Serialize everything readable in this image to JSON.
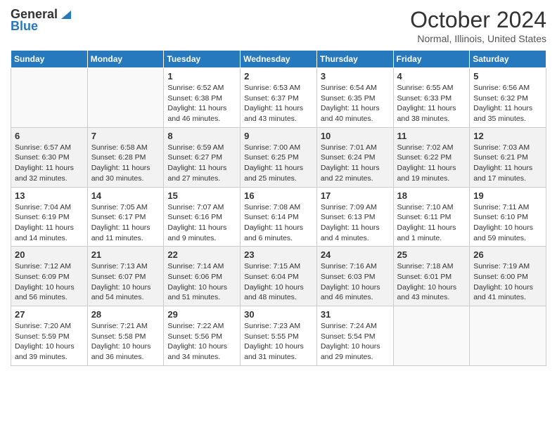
{
  "logo": {
    "general": "General",
    "blue": "Blue"
  },
  "title": "October 2024",
  "location": "Normal, Illinois, United States",
  "days_of_week": [
    "Sunday",
    "Monday",
    "Tuesday",
    "Wednesday",
    "Thursday",
    "Friday",
    "Saturday"
  ],
  "weeks": [
    [
      {
        "day": "",
        "detail": ""
      },
      {
        "day": "",
        "detail": ""
      },
      {
        "day": "1",
        "detail": "Sunrise: 6:52 AM\nSunset: 6:38 PM\nDaylight: 11 hours and 46 minutes."
      },
      {
        "day": "2",
        "detail": "Sunrise: 6:53 AM\nSunset: 6:37 PM\nDaylight: 11 hours and 43 minutes."
      },
      {
        "day": "3",
        "detail": "Sunrise: 6:54 AM\nSunset: 6:35 PM\nDaylight: 11 hours and 40 minutes."
      },
      {
        "day": "4",
        "detail": "Sunrise: 6:55 AM\nSunset: 6:33 PM\nDaylight: 11 hours and 38 minutes."
      },
      {
        "day": "5",
        "detail": "Sunrise: 6:56 AM\nSunset: 6:32 PM\nDaylight: 11 hours and 35 minutes."
      }
    ],
    [
      {
        "day": "6",
        "detail": "Sunrise: 6:57 AM\nSunset: 6:30 PM\nDaylight: 11 hours and 32 minutes."
      },
      {
        "day": "7",
        "detail": "Sunrise: 6:58 AM\nSunset: 6:28 PM\nDaylight: 11 hours and 30 minutes."
      },
      {
        "day": "8",
        "detail": "Sunrise: 6:59 AM\nSunset: 6:27 PM\nDaylight: 11 hours and 27 minutes."
      },
      {
        "day": "9",
        "detail": "Sunrise: 7:00 AM\nSunset: 6:25 PM\nDaylight: 11 hours and 25 minutes."
      },
      {
        "day": "10",
        "detail": "Sunrise: 7:01 AM\nSunset: 6:24 PM\nDaylight: 11 hours and 22 minutes."
      },
      {
        "day": "11",
        "detail": "Sunrise: 7:02 AM\nSunset: 6:22 PM\nDaylight: 11 hours and 19 minutes."
      },
      {
        "day": "12",
        "detail": "Sunrise: 7:03 AM\nSunset: 6:21 PM\nDaylight: 11 hours and 17 minutes."
      }
    ],
    [
      {
        "day": "13",
        "detail": "Sunrise: 7:04 AM\nSunset: 6:19 PM\nDaylight: 11 hours and 14 minutes."
      },
      {
        "day": "14",
        "detail": "Sunrise: 7:05 AM\nSunset: 6:17 PM\nDaylight: 11 hours and 11 minutes."
      },
      {
        "day": "15",
        "detail": "Sunrise: 7:07 AM\nSunset: 6:16 PM\nDaylight: 11 hours and 9 minutes."
      },
      {
        "day": "16",
        "detail": "Sunrise: 7:08 AM\nSunset: 6:14 PM\nDaylight: 11 hours and 6 minutes."
      },
      {
        "day": "17",
        "detail": "Sunrise: 7:09 AM\nSunset: 6:13 PM\nDaylight: 11 hours and 4 minutes."
      },
      {
        "day": "18",
        "detail": "Sunrise: 7:10 AM\nSunset: 6:11 PM\nDaylight: 11 hours and 1 minute."
      },
      {
        "day": "19",
        "detail": "Sunrise: 7:11 AM\nSunset: 6:10 PM\nDaylight: 10 hours and 59 minutes."
      }
    ],
    [
      {
        "day": "20",
        "detail": "Sunrise: 7:12 AM\nSunset: 6:09 PM\nDaylight: 10 hours and 56 minutes."
      },
      {
        "day": "21",
        "detail": "Sunrise: 7:13 AM\nSunset: 6:07 PM\nDaylight: 10 hours and 54 minutes."
      },
      {
        "day": "22",
        "detail": "Sunrise: 7:14 AM\nSunset: 6:06 PM\nDaylight: 10 hours and 51 minutes."
      },
      {
        "day": "23",
        "detail": "Sunrise: 7:15 AM\nSunset: 6:04 PM\nDaylight: 10 hours and 48 minutes."
      },
      {
        "day": "24",
        "detail": "Sunrise: 7:16 AM\nSunset: 6:03 PM\nDaylight: 10 hours and 46 minutes."
      },
      {
        "day": "25",
        "detail": "Sunrise: 7:18 AM\nSunset: 6:01 PM\nDaylight: 10 hours and 43 minutes."
      },
      {
        "day": "26",
        "detail": "Sunrise: 7:19 AM\nSunset: 6:00 PM\nDaylight: 10 hours and 41 minutes."
      }
    ],
    [
      {
        "day": "27",
        "detail": "Sunrise: 7:20 AM\nSunset: 5:59 PM\nDaylight: 10 hours and 39 minutes."
      },
      {
        "day": "28",
        "detail": "Sunrise: 7:21 AM\nSunset: 5:58 PM\nDaylight: 10 hours and 36 minutes."
      },
      {
        "day": "29",
        "detail": "Sunrise: 7:22 AM\nSunset: 5:56 PM\nDaylight: 10 hours and 34 minutes."
      },
      {
        "day": "30",
        "detail": "Sunrise: 7:23 AM\nSunset: 5:55 PM\nDaylight: 10 hours and 31 minutes."
      },
      {
        "day": "31",
        "detail": "Sunrise: 7:24 AM\nSunset: 5:54 PM\nDaylight: 10 hours and 29 minutes."
      },
      {
        "day": "",
        "detail": ""
      },
      {
        "day": "",
        "detail": ""
      }
    ]
  ]
}
